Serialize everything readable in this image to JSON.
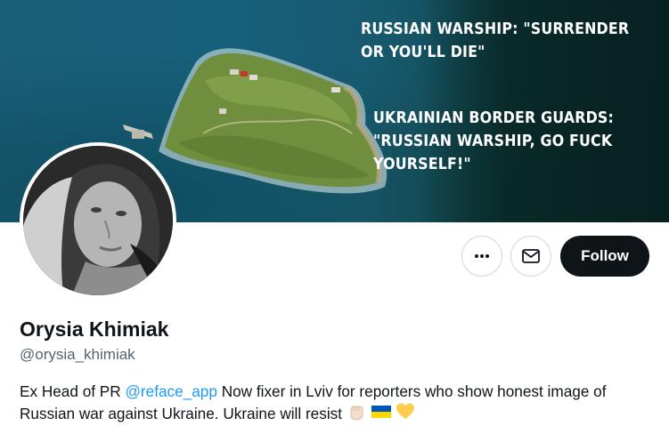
{
  "banner": {
    "line1": "RUSSIAN WARSHIP: \"SURRENDER OR YOU'LL DIE\"",
    "line2": "UKRAINIAN BORDER GUARDS: \"RUSSIAN WARSHIP, GO FUCK YOURSELF!\""
  },
  "actions": {
    "more_icon": "more-horizontal-icon",
    "mail_icon": "mail-icon",
    "follow_label": "Follow"
  },
  "profile": {
    "name": "Orysia Khimiak",
    "handle": "@orysia_khimiak",
    "bio_prefix": "Ex Head of PR ",
    "bio_mention": "@reface_app",
    "bio_suffix": " Now fixer in Lviv for reporters who show honest image of Russian war against Ukraine.  Ukraine will resist ",
    "bio_emojis": [
      "raised-fist-emoji",
      "ukraine-flag-emoji",
      "yellow-heart-emoji"
    ]
  },
  "colors": {
    "accent": "#1d9bf0",
    "follow_bg": "#0f1419",
    "muted_text": "#536471",
    "border": "#cfd9de"
  }
}
